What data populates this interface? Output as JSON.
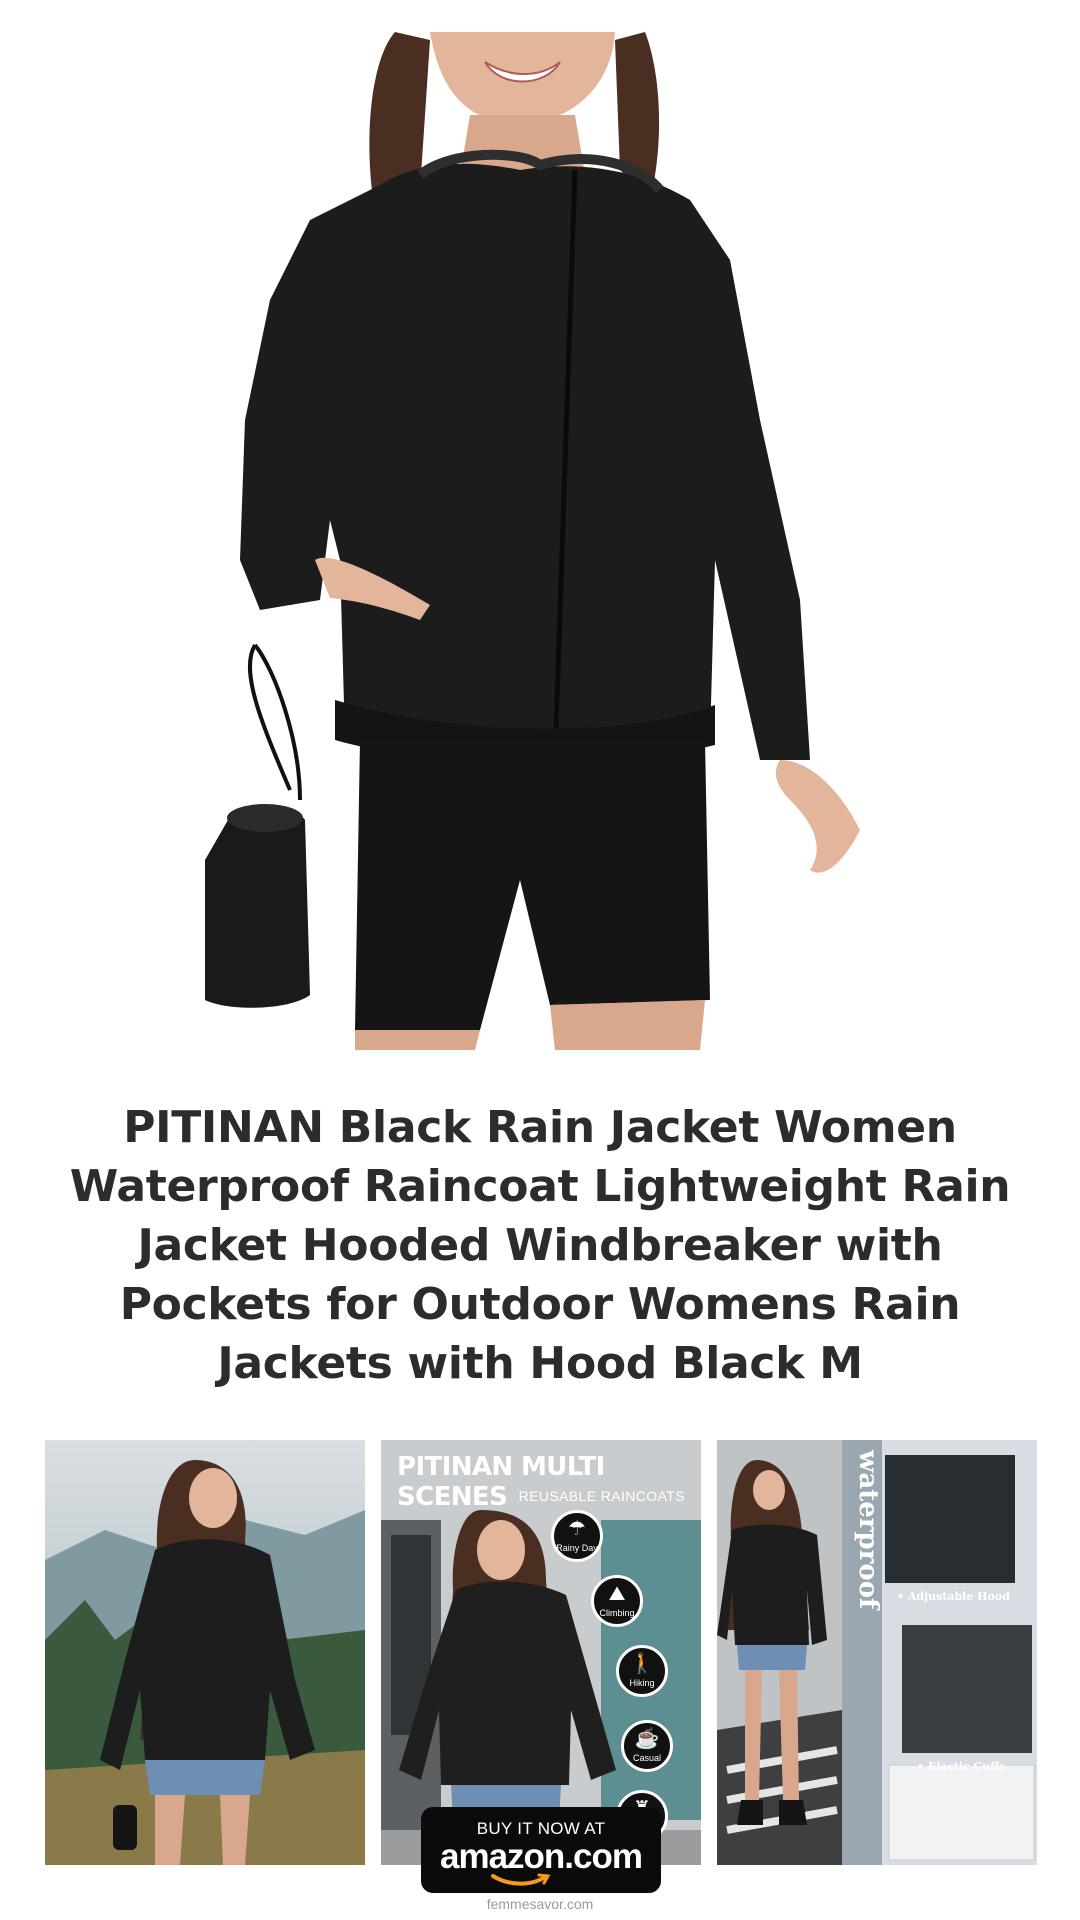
{
  "product": {
    "title": "PITINAN Black Rain Jacket Women Waterproof Raincoat Lightweight Rain Jacket Hooded Windbreaker with Pockets for Outdoor Womens Rain Jackets with Hood Black M"
  },
  "thumbnails": [
    {
      "name": "outdoor-scene"
    },
    {
      "name": "multi-scenes",
      "title": "PITINAN MULTI SCENES",
      "subtitle": "REUSABLE RAINCOATS",
      "icons": [
        {
          "label": "Rainy Day",
          "icon": "rain-cloud-icon"
        },
        {
          "label": "Climbing",
          "icon": "climbing-icon"
        },
        {
          "label": "Hiking",
          "icon": "hiking-icon"
        },
        {
          "label": "Casual",
          "icon": "coffee-cup-icon"
        },
        {
          "label": "",
          "icon": "lamp-icon"
        }
      ]
    },
    {
      "name": "features",
      "vertical_word": "waterproof",
      "features": [
        "• Adjustable Hood",
        "• Elastic Cuffs"
      ]
    }
  ],
  "cta": {
    "line1": "BUY IT NOW AT",
    "line2": "amazon.com"
  },
  "footer": {
    "site": "femmesavor.com"
  },
  "colors": {
    "jacket": "#1c1c1c",
    "title_text": "#2c2c2c",
    "amazon_orange": "#f59a1b"
  }
}
